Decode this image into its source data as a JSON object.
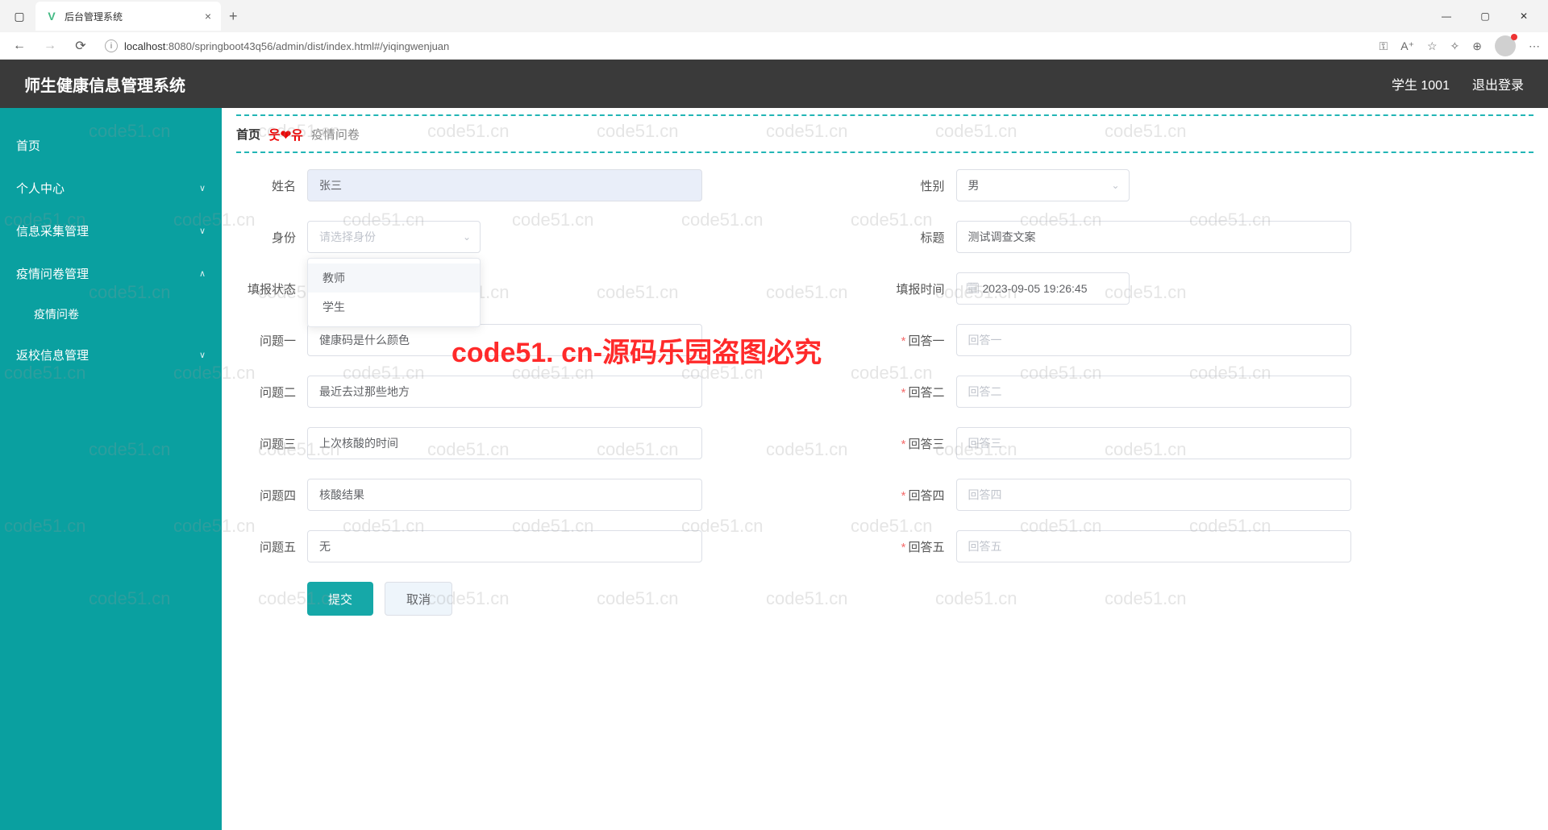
{
  "browser": {
    "tab_title": "后台管理系统",
    "url_host": "localhost",
    "url_path": ":8080/springboot43q56/admin/dist/index.html#/yiqingwenjuan"
  },
  "header": {
    "system_title": "师生健康信息管理系统",
    "user_label": "学生 1001",
    "logout": "退出登录"
  },
  "sidebar": {
    "items": [
      {
        "label": "首页",
        "expandable": false
      },
      {
        "label": "个人中心",
        "expandable": true,
        "chev": "∨"
      },
      {
        "label": "信息采集管理",
        "expandable": true,
        "chev": "∨"
      },
      {
        "label": "疫情问卷管理",
        "expandable": true,
        "chev": "∧"
      },
      {
        "label": "返校信息管理",
        "expandable": true,
        "chev": "∨"
      }
    ],
    "sub_item": "疫情问卷"
  },
  "breadcrumb": {
    "home": "首页",
    "mid": "웃❤유",
    "page": "疫情问卷"
  },
  "form": {
    "name_label": "姓名",
    "name_value": "张三",
    "gender_label": "性别",
    "gender_value": "男",
    "identity_label": "身份",
    "identity_placeholder": "请选择身份",
    "title_label": "标题",
    "title_value": "测试调查文案",
    "status_label": "填报状态",
    "status_value": "",
    "time_label": "填报时间",
    "time_value": "2023-09-05 19:26:45",
    "q1_label": "问题一",
    "q1_value": "健康码是什么颜色",
    "a1_label": "回答一",
    "a1_placeholder": "回答一",
    "q2_label": "问题二",
    "q2_value": "最近去过那些地方",
    "a2_label": "回答二",
    "a2_placeholder": "回答二",
    "q3_label": "问题三",
    "q3_value": "上次核酸的时间",
    "a3_label": "回答三",
    "a3_placeholder": "回答三",
    "q4_label": "问题四",
    "q4_value": "核酸结果",
    "a4_label": "回答四",
    "a4_placeholder": "回答四",
    "q5_label": "问题五",
    "q5_value": "无",
    "a5_label": "回答五",
    "a5_placeholder": "回答五",
    "submit": "提交",
    "cancel": "取消",
    "dropdown_options": [
      "教师",
      "学生"
    ]
  },
  "watermark": {
    "text": "code51.cn",
    "red": "code51. cn-源码乐园盗图必究"
  }
}
